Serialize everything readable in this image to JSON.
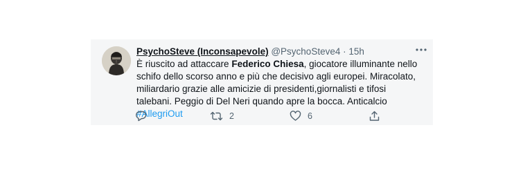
{
  "tweet": {
    "display_name": "PsychoSteve (Inconsapevole)",
    "handle": "@PsychoSteve4",
    "separator": "·",
    "time": "15h",
    "text_parts": {
      "p1": "È riuscito ad attaccare ",
      "bold": "Federico Chiesa",
      "p2": ", giocatore illuminante nello schifo dello scorso anno e più che decisivo agli europei. Miracolato, miliardario grazie alle amicizie di presidenti,giornalisti e tifosi talebani. Peggio di Del Neri quando apre la bocca. Anticalcio ",
      "hashtag": "#AllegriOut"
    },
    "retweet_count": "2",
    "like_count": "6",
    "hashtag_color": "#1d9bf0",
    "icons": [
      "reply-icon",
      "retweet-icon",
      "like-icon",
      "share-icon",
      "more-icon"
    ]
  }
}
